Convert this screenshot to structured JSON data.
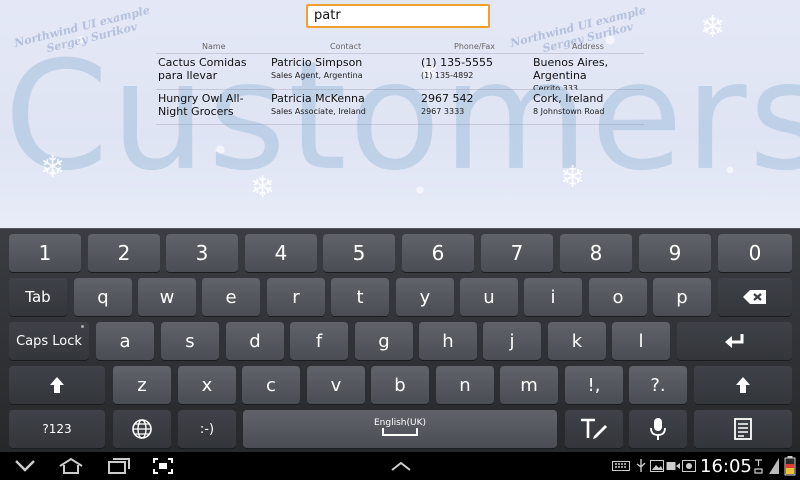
{
  "app": {
    "watermark": "Customers",
    "credit_line1": "Northwind UI example",
    "credit_line2": "Sergey Surikov",
    "search_value": "patr"
  },
  "table": {
    "headers": [
      "Name",
      "Contact",
      "Phone/Fax",
      "Address"
    ],
    "rows": [
      {
        "name": "Cactus Comidas para llevar",
        "contact": "Patricio Simpson",
        "title": "Sales Agent, Argentina",
        "phone": "(1) 135-5555",
        "fax": "(1) 135-4892",
        "address": "Buenos Aires, Argentina",
        "street": "Cerrito 333"
      },
      {
        "name": "Hungry Owl All-Night Grocers",
        "contact": "Patricia McKenna",
        "title": "Sales Associate, Ireland",
        "phone": "2967 542",
        "fax": "2967 3333",
        "address": "Cork, Ireland",
        "street": "8 Johnstown Road"
      }
    ]
  },
  "keyboard": {
    "row1": [
      "1",
      "2",
      "3",
      "4",
      "5",
      "6",
      "7",
      "8",
      "9",
      "0"
    ],
    "tab": "Tab",
    "row2": [
      "q",
      "w",
      "e",
      "r",
      "t",
      "y",
      "u",
      "i",
      "o",
      "p"
    ],
    "caps": "Caps Lock",
    "row3": [
      "a",
      "s",
      "d",
      "f",
      "g",
      "h",
      "j",
      "k",
      "l"
    ],
    "row4": [
      "z",
      "x",
      "c",
      "v",
      "b",
      "n",
      "m"
    ],
    "comma_key": "!,",
    "period_key": "?.",
    "symbols": "?123",
    "smiley": ":-)",
    "space_label": "English(UK)"
  },
  "status": {
    "clock": "16:05"
  },
  "colors": {
    "search_border": "#f0a030",
    "keyboard_bg": "#2e3035",
    "key_bg": "#565a60"
  },
  "icons": [
    "backspace-icon",
    "enter-icon",
    "shift-icon",
    "globe-icon",
    "text-edit-icon",
    "microphone-icon",
    "clipboard-icon",
    "back-icon",
    "home-icon",
    "recent-apps-icon",
    "screenshot-icon",
    "chevron-up-icon",
    "keyboard-icon",
    "usb-icon",
    "gallery-icon",
    "video-icon",
    "battery-icon"
  ]
}
